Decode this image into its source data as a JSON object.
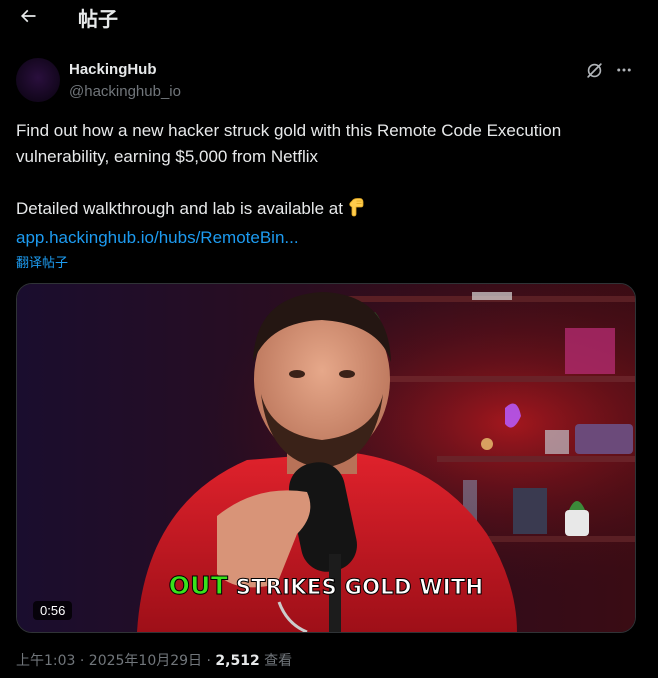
{
  "header": {
    "title": "帖子"
  },
  "author": {
    "display_name": "HackingHub",
    "handle": "@hackinghub_io"
  },
  "tweet": {
    "line1": "Find out how a new hacker struck gold with this Remote Code Execution vulnerability, earning $5,000 from Netflix",
    "line2": "Detailed walkthrough and lab is available at",
    "link": "app.hackinghub.io/hubs/RemoteBin...",
    "translate": "翻译帖子"
  },
  "video": {
    "duration": "0:56",
    "caption_highlight": "OUT",
    "caption_rest": "STRIKES GOLD WITH"
  },
  "meta": {
    "time": "上午1:03 · 2025年10月29日",
    "separator": "·",
    "views": "2,512",
    "views_label": "查看"
  },
  "colors": {
    "accent": "#1d9bf0",
    "text": "#e7e9ea",
    "muted": "#71767b",
    "caption_green": "#39e21b"
  },
  "icons": {
    "back": "arrow-left-icon",
    "grok": "grok-icon",
    "more": "more-horizontal-icon",
    "emoji": "pointing-down-emoji"
  }
}
